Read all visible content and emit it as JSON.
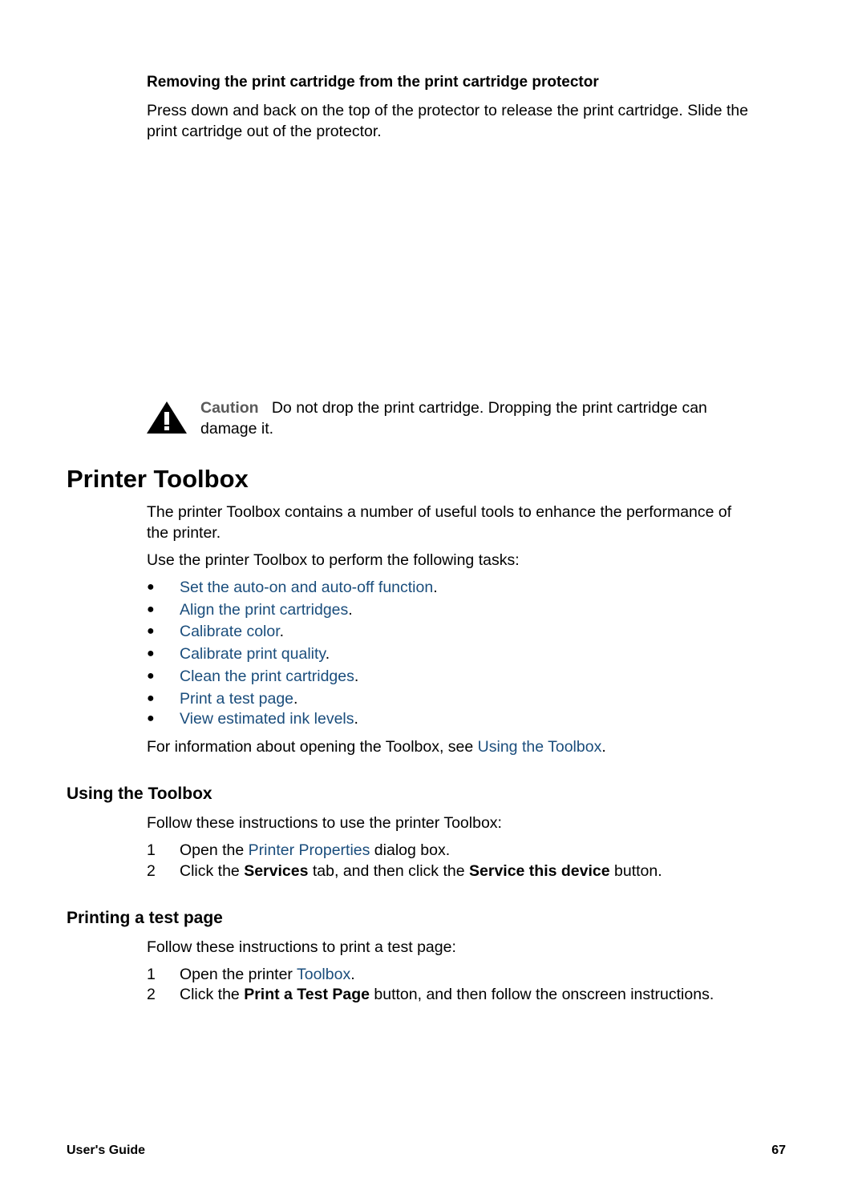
{
  "section_removing": {
    "heading": "Removing the print cartridge from the print cartridge protector",
    "line1": "Press down and back on the top of the protector to release the print cartridge. Slide the",
    "line2": "print cartridge out of the protector."
  },
  "caution": {
    "icon": "warning-triangle-icon",
    "label": "Caution",
    "line1": "Do not drop the print cartridge. Dropping the print cartridge can",
    "line2": "damage it."
  },
  "printer_toolbox": {
    "title": "Printer Toolbox",
    "intro_line1": "The printer Toolbox contains a number of useful tools to enhance the performance of",
    "intro_line2": "the printer.",
    "tasks_intro": "Use the printer Toolbox to perform the following tasks:",
    "bullet_glyph": "●",
    "tasks": [
      {
        "link": "Set the auto-on and auto-off function",
        "suffix": "."
      },
      {
        "link": "Align the print cartridges",
        "suffix": "."
      },
      {
        "link": "Calibrate color",
        "suffix": "."
      },
      {
        "link": "Calibrate print quality",
        "suffix": "."
      },
      {
        "link": "Clean the print cartridges",
        "suffix": "."
      },
      {
        "link": "Print a test page",
        "suffix": "."
      },
      {
        "link": "View estimated ink levels",
        "suffix": "."
      }
    ],
    "info_prefix": "For information about opening the Toolbox, see ",
    "info_link": "Using the Toolbox",
    "info_suffix": "."
  },
  "using_toolbox": {
    "title": "Using the Toolbox",
    "intro": "Follow these instructions to use the printer Toolbox:",
    "steps": [
      {
        "num": "1",
        "prefix": "Open the ",
        "link": "Printer Properties",
        "suffix": " dialog box."
      },
      {
        "num": "2",
        "prefix": "Click the ",
        "bold1": "Services",
        "mid": " tab, and then click the ",
        "bold2": "Service this device",
        "suffix": " button."
      }
    ]
  },
  "printing_test_page": {
    "title": "Printing a test page",
    "intro": "Follow these instructions to print a test page:",
    "steps": [
      {
        "num": "1",
        "prefix": "Open the printer ",
        "link": "Toolbox",
        "suffix": "."
      },
      {
        "num": "2",
        "prefix": "Click the ",
        "bold1": "Print a Test Page",
        "suffix": " button, and then follow the onscreen instructions."
      }
    ]
  },
  "footer": {
    "left": "User's Guide",
    "page_number": "67"
  },
  "colors": {
    "link": "#1a4d7c",
    "caution_label": "#5a5a5a",
    "text": "#000000"
  }
}
